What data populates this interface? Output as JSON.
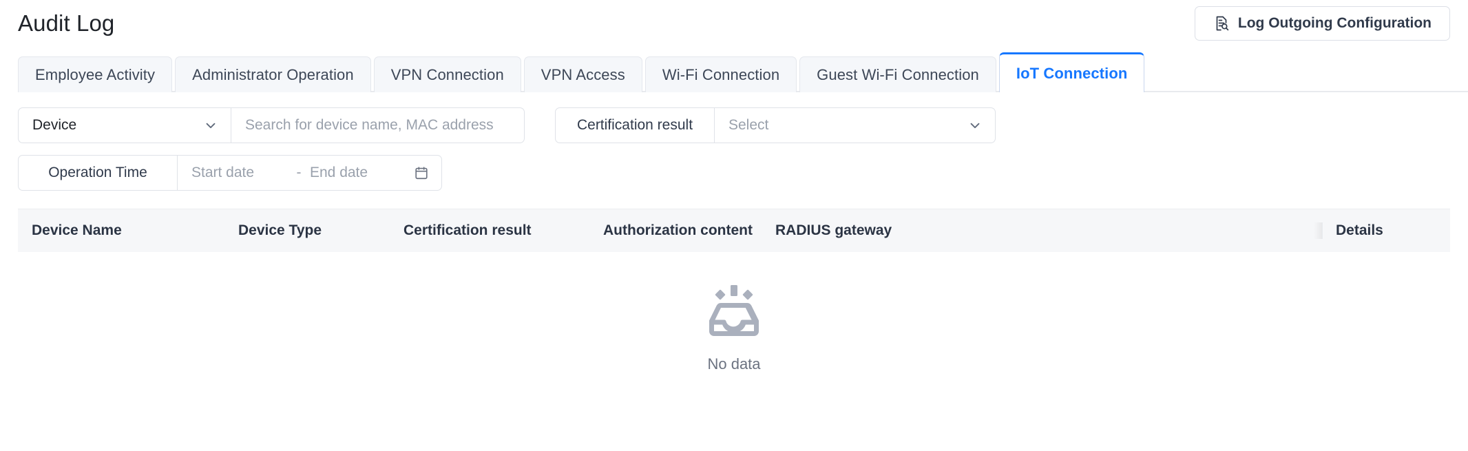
{
  "header": {
    "title": "Audit Log",
    "outgoing_button": {
      "label": "Log Outgoing Configuration",
      "icon": "document-search-icon"
    }
  },
  "tabs": [
    {
      "label": "Employee Activity",
      "active": false
    },
    {
      "label": "Administrator Operation",
      "active": false
    },
    {
      "label": "VPN Connection",
      "active": false
    },
    {
      "label": "VPN Access",
      "active": false
    },
    {
      "label": "Wi-Fi Connection",
      "active": false
    },
    {
      "label": "Guest Wi-Fi Connection",
      "active": false
    },
    {
      "label": "IoT Connection",
      "active": true
    }
  ],
  "filters": {
    "device": {
      "select_label": "Device",
      "select_icon": "chevron-down-icon",
      "search_placeholder": "Search for device name, MAC address",
      "search_value": ""
    },
    "certification": {
      "label": "Certification result",
      "select_placeholder": "Select",
      "select_icon": "chevron-down-icon"
    },
    "operation_time": {
      "label": "Operation Time",
      "start_placeholder": "Start date",
      "separator": "-",
      "end_placeholder": "End date",
      "calendar_icon": "calendar-icon"
    }
  },
  "table": {
    "columns": [
      "Device Name",
      "Device Type",
      "Certification result",
      "Authorization content",
      "RADIUS gateway"
    ],
    "fixed_column": "Details",
    "empty": {
      "icon": "empty-inbox-icon",
      "text": "No data"
    }
  },
  "colors": {
    "accent": "#1677ff",
    "title_text": "#1f2329",
    "tab_inactive_bg": "#f5f7fa",
    "table_header_bg": "#f6f7f9",
    "placeholder": "#9aa1ac",
    "empty_icon": "#aab0bd"
  }
}
